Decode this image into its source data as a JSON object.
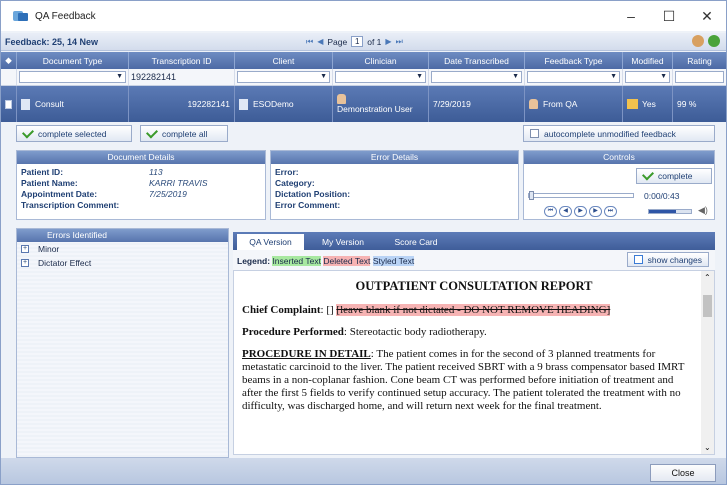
{
  "window": {
    "title": "QA Feedback",
    "minimize": "–",
    "maximize": "☐",
    "close": "✕"
  },
  "header": {
    "feedback_count": "Feedback: 25, 14 New",
    "page_label": "Page",
    "page_value": "1",
    "page_of": "of 1"
  },
  "grid": {
    "columns": [
      "Document Type",
      "Transcription ID",
      "Client",
      "Clinician",
      "Date Transcribed",
      "Feedback Type",
      "Modified",
      "Rating"
    ],
    "filter_transcription_id": "192282141",
    "row": {
      "document_type": "Consult",
      "transcription_id": "192282141",
      "client": "ESODemo",
      "clinician": "Demonstration User",
      "date_transcribed": "7/29/2019",
      "feedback_type": "From QA",
      "modified": "Yes",
      "rating": "99 %"
    }
  },
  "buttons": {
    "complete_selected": "complete selected",
    "complete_all": "complete all",
    "autocomplete": "autocomplete unmodified feedback",
    "complete": "complete",
    "show_changes": "show changes",
    "close": "Close"
  },
  "document_details": {
    "title": "Document Details",
    "fields": [
      {
        "label": "Patient ID:",
        "value": "113"
      },
      {
        "label": "Patient Name:",
        "value": "KARRI TRAVIS"
      },
      {
        "label": "Appointment Date:",
        "value": "7/25/2019"
      },
      {
        "label": "Transcription Comment:",
        "value": ""
      }
    ]
  },
  "error_details": {
    "title": "Error Details",
    "fields": [
      "Error:",
      "Category:",
      "Dictation Position:",
      "Error Comment:"
    ]
  },
  "controls": {
    "title": "Controls",
    "time": "0:00/0:43",
    "playback_progress": 0,
    "volume_level": 0.65
  },
  "errors": {
    "title": "Errors Identified",
    "items": [
      "Minor",
      "Dictator Effect"
    ]
  },
  "tabs": [
    "QA Version",
    "My Version",
    "Score Card"
  ],
  "legend": {
    "label": "Legend:",
    "inserted": "Inserted Text",
    "deleted": "Deleted Text",
    "styled": "Styled Text"
  },
  "report": {
    "title": "OUTPATIENT CONSULTATION REPORT",
    "cc_label": "Chief Complaint",
    "cc_text": ": [] ",
    "cc_deleted": "[leave blank if not dictated - DO NOT REMOVE HEADING]",
    "pp_label": "Procedure Performed",
    "pp_text": ": Stereotactic body radiotherapy.",
    "pd_label": "PROCEDURE IN DETAIL",
    "pd_text": ": The patient comes in for the second of 3 planned treatments for metastatic carcinoid to the liver. The patient received SBRT with a 9 brass compensator based IMRT beams in a non-coplanar fashion. Cone beam CT was performed before initiation of treatment and after the first 5 fields to verify continued setup accuracy. The patient tolerated the treatment with no difficulty, was discharged home, and will return next week for the final treatment."
  },
  "colors": {
    "inserted": "#a7e8a0",
    "deleted": "#f6b3b3",
    "styled": "#b9d3f5",
    "header_blue": "#4d6aa5"
  }
}
